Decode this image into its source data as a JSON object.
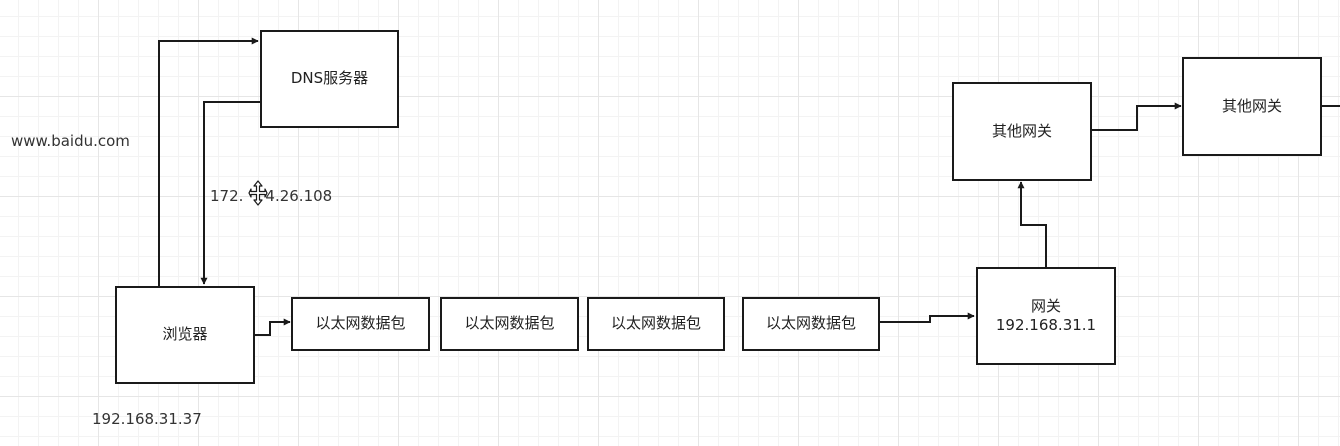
{
  "nodes": {
    "dns": "DNS服务器",
    "browser": "浏览器",
    "packets": [
      "以太网数据包",
      "以太网数据包",
      "以太网数据包",
      "以太网数据包"
    ],
    "gateway": {
      "name": "网关",
      "ip": "192.168.31.1"
    },
    "other_gateway_1": "其他网关",
    "other_gateway_2": "其他网关"
  },
  "labels": {
    "domain": "www.baidu.com",
    "dns_reply_ip": "172.",
    "dns_reply_ip_tail": "4.26.108",
    "browser_ip": "192.168.31.37"
  },
  "colors": {
    "stroke": "#1a1a1a",
    "grid": "#e6e6e6"
  },
  "icons": {
    "cursor": "move-cursor-icon"
  }
}
